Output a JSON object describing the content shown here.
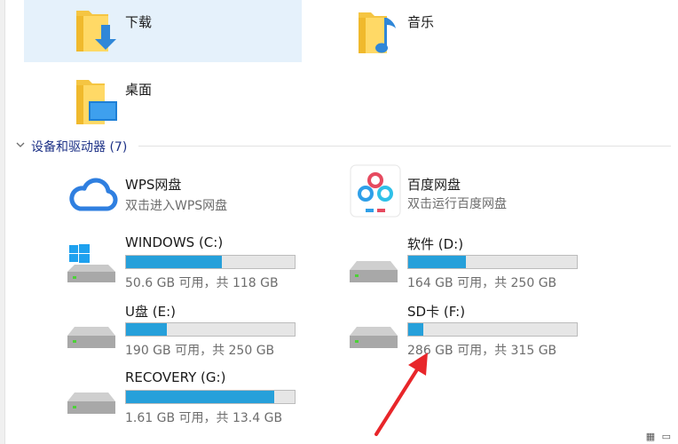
{
  "quick_folders": [
    {
      "label": "下载",
      "icon": "downloads-folder-icon",
      "selected": true
    },
    {
      "label": "音乐",
      "icon": "music-folder-icon",
      "selected": false
    },
    {
      "label": "桌面",
      "icon": "desktop-folder-icon",
      "selected": false
    }
  ],
  "devices_section": {
    "title": "设备和驱动器 (7)"
  },
  "apps": [
    {
      "name": "WPS网盘",
      "subtitle": "双击进入WPS网盘",
      "icon": "wps-cloud-icon"
    },
    {
      "name": "百度网盘",
      "subtitle": "双击运行百度网盘",
      "icon": "baidu-netdisk-icon"
    }
  ],
  "drives": [
    {
      "name": "WINDOWS (C:)",
      "size_text": "50.6 GB 可用，共 118 GB",
      "used_fraction": 0.571,
      "icon": "windows-drive-icon"
    },
    {
      "name": "软件 (D:)",
      "size_text": "164 GB 可用，共 250 GB",
      "used_fraction": 0.344,
      "icon": "hard-drive-icon"
    },
    {
      "name": "U盘 (E:)",
      "size_text": "190 GB 可用，共 250 GB",
      "used_fraction": 0.24,
      "icon": "hard-drive-icon"
    },
    {
      "name": "SD卡 (F:)",
      "size_text": "286 GB 可用，共 315 GB",
      "used_fraction": 0.092,
      "icon": "hard-drive-icon"
    },
    {
      "name": "RECOVERY (G:)",
      "size_text": "1.61 GB 可用，共 13.4 GB",
      "used_fraction": 0.88,
      "icon": "hard-drive-icon"
    }
  ],
  "colors": {
    "bar_fill": "#26a0da",
    "selection": "#e5f1fb",
    "annotation_arrow": "#e8262a",
    "section_title": "#1e3287"
  }
}
